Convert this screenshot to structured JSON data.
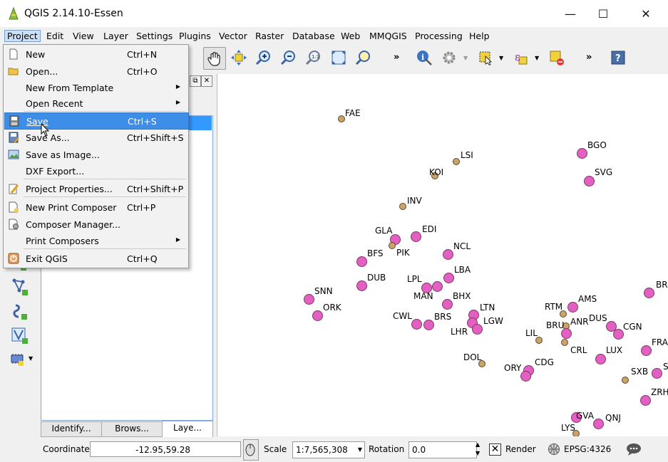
{
  "window": {
    "title": "QGIS 2.14.10-Essen",
    "minimize": "—",
    "maximize": "☐",
    "close": "✕"
  },
  "menubar": {
    "items": [
      "Project",
      "Edit",
      "View",
      "Layer",
      "Settings",
      "Plugins",
      "Vector",
      "Raster",
      "Database",
      "Web",
      "MMQGIS",
      "Processing",
      "Help"
    ]
  },
  "toolbar": {
    "more1": "»",
    "more2": "»",
    "more3": "»"
  },
  "project_menu": {
    "items": [
      {
        "label": "New",
        "shortcut": "Ctrl+N",
        "icon": "new-document-icon"
      },
      {
        "label": "Open...",
        "shortcut": "Ctrl+O",
        "icon": "open-folder-icon"
      },
      {
        "label": "New From Template",
        "shortcut": "",
        "submenu": true
      },
      {
        "label": "Open Recent",
        "shortcut": "",
        "submenu": true
      },
      {
        "label": "Save",
        "shortcut": "Ctrl+S",
        "icon": "save-icon",
        "highlighted": true
      },
      {
        "label": "Save As...",
        "shortcut": "Ctrl+Shift+S",
        "icon": "save-as-icon"
      },
      {
        "label": "Save as Image...",
        "shortcut": "",
        "icon": "save-image-icon"
      },
      {
        "label": "DXF Export...",
        "shortcut": ""
      },
      {
        "label": "Project Properties...",
        "shortcut": "Ctrl+Shift+P",
        "icon": "properties-icon"
      },
      {
        "label": "New Print Composer",
        "shortcut": "Ctrl+P",
        "icon": "new-composer-icon"
      },
      {
        "label": "Composer Manager...",
        "shortcut": "",
        "icon": "composer-manager-icon"
      },
      {
        "label": "Print Composers",
        "shortcut": "",
        "submenu": true
      },
      {
        "label": "Exit QGIS",
        "shortcut": "Ctrl+Q",
        "icon": "exit-icon"
      }
    ],
    "submenu_arrow": "▶"
  },
  "panel_tabs": [
    "Identify...",
    "Brows...",
    "Laye..."
  ],
  "dock_buttons": [
    "⧉",
    "✕"
  ],
  "map": {
    "airports": [
      {
        "code": "FAE",
        "size": "small"
      },
      {
        "code": "LSI",
        "size": "small"
      },
      {
        "code": "BGO",
        "size": "big"
      },
      {
        "code": "KOI",
        "size": "small"
      },
      {
        "code": "SVG",
        "size": "big"
      },
      {
        "code": "INV",
        "size": "small"
      },
      {
        "code": "EDI",
        "size": "big"
      },
      {
        "code": "GLA",
        "size": "big"
      },
      {
        "code": "PIK",
        "size": "small"
      },
      {
        "code": "NCL",
        "size": "big"
      },
      {
        "code": "BFS",
        "size": "big"
      },
      {
        "code": "LBA",
        "size": "big"
      },
      {
        "code": "DUB",
        "size": "big"
      },
      {
        "code": "LPL",
        "size": "big"
      },
      {
        "code": "MAN",
        "size": "big"
      },
      {
        "code": "SNN",
        "size": "big"
      },
      {
        "code": "BHX",
        "size": "big"
      },
      {
        "code": "ORK",
        "size": "big"
      },
      {
        "code": "LTN",
        "size": "big"
      },
      {
        "code": "CWL",
        "size": "big"
      },
      {
        "code": "BRS",
        "size": "big"
      },
      {
        "code": "LGW",
        "size": "big"
      },
      {
        "code": "LHR",
        "size": "big"
      },
      {
        "code": "AMS",
        "size": "big"
      },
      {
        "code": "RTM",
        "size": "small"
      },
      {
        "code": "DUS",
        "size": "big"
      },
      {
        "code": "ANR",
        "size": "small"
      },
      {
        "code": "BRU",
        "size": "big"
      },
      {
        "code": "CGN",
        "size": "big"
      },
      {
        "code": "LIL",
        "size": "small"
      },
      {
        "code": "CRL",
        "size": "small"
      },
      {
        "code": "LUX",
        "size": "big"
      },
      {
        "code": "DOL",
        "size": "small"
      },
      {
        "code": "CDG",
        "size": "big"
      },
      {
        "code": "ORY",
        "size": "big"
      },
      {
        "code": "SXB",
        "size": "small"
      },
      {
        "code": "GVA",
        "size": "big"
      },
      {
        "code": "QNJ",
        "size": "big"
      },
      {
        "code": "LYS",
        "size": "small"
      },
      {
        "code": "BR",
        "size": "big"
      },
      {
        "code": "FRA",
        "size": "big"
      },
      {
        "code": "ZRH",
        "size": "big"
      },
      {
        "code": "S",
        "size": "big"
      }
    ]
  },
  "statusbar": {
    "coordinate_label": "Coordinate",
    "coordinate_value": "-12.95,59.28",
    "scale_label": "Scale",
    "scale_value": "1:7,565,308",
    "rotation_label": "Rotation",
    "rotation_value": "0.0",
    "render_label": "Render",
    "epsg_label": "EPSG:4326"
  },
  "colors": {
    "highlight": "#3d8ee8",
    "airport_big": "#e35fc2",
    "airport_small": "#c9a36a",
    "layer_selection": "#3399ff"
  }
}
